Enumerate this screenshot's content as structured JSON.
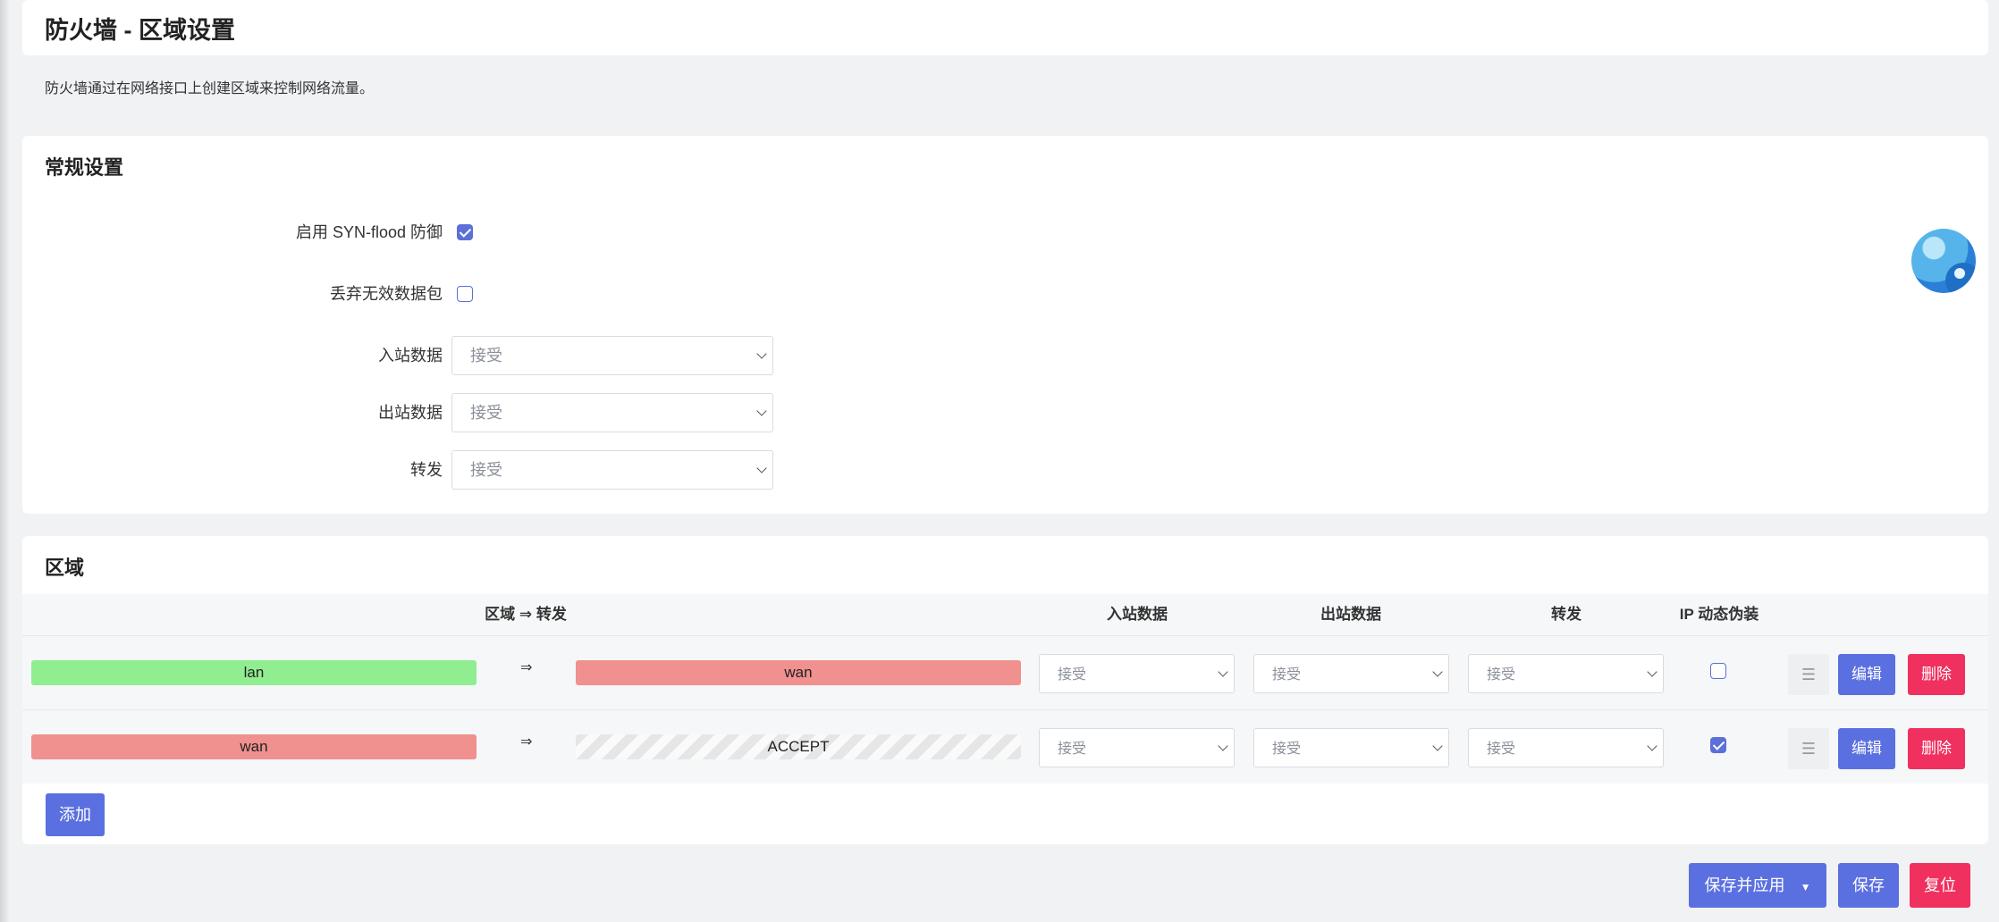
{
  "page": {
    "title": "防火墙 - 区域设置",
    "description": "防火墙通过在网络接口上创建区域来控制网络流量。"
  },
  "general": {
    "title": "常规设置",
    "syn_flood": {
      "label": "启用 SYN-flood 防御",
      "checked": true
    },
    "drop_invalid": {
      "label": "丢弃无效数据包",
      "checked": false
    },
    "input": {
      "label": "入站数据",
      "value": "接受"
    },
    "output": {
      "label": "出站数据",
      "value": "接受"
    },
    "forward": {
      "label": "转发",
      "value": "接受"
    }
  },
  "zones": {
    "title": "区域",
    "headers": {
      "zone_forward": "区域 ⇒ 转发",
      "input": "入站数据",
      "output": "出站数据",
      "forward": "转发",
      "masq": "IP 动态伪装"
    },
    "rows": [
      {
        "zone": "lan",
        "zone_color": "#90ee90",
        "arrow": "⇒",
        "dest": "wan",
        "dest_color": "#f0908f",
        "input": "接受",
        "output": "接受",
        "forward": "接受",
        "masq": false,
        "edit": "编辑",
        "delete": "删除",
        "handle": "☰"
      },
      {
        "zone": "wan",
        "zone_color": "#f0908f",
        "arrow": "⇒",
        "dest": "ACCEPT",
        "dest_color": "hatched",
        "input": "接受",
        "output": "接受",
        "forward": "接受",
        "masq": true,
        "edit": "编辑",
        "delete": "删除",
        "handle": "☰"
      }
    ],
    "add_label": "添加"
  },
  "footer": {
    "save_apply": "保存并应用",
    "save": "保存",
    "reset": "复位"
  },
  "colors": {
    "accent": "#5b70e0",
    "danger": "#f0305f"
  }
}
